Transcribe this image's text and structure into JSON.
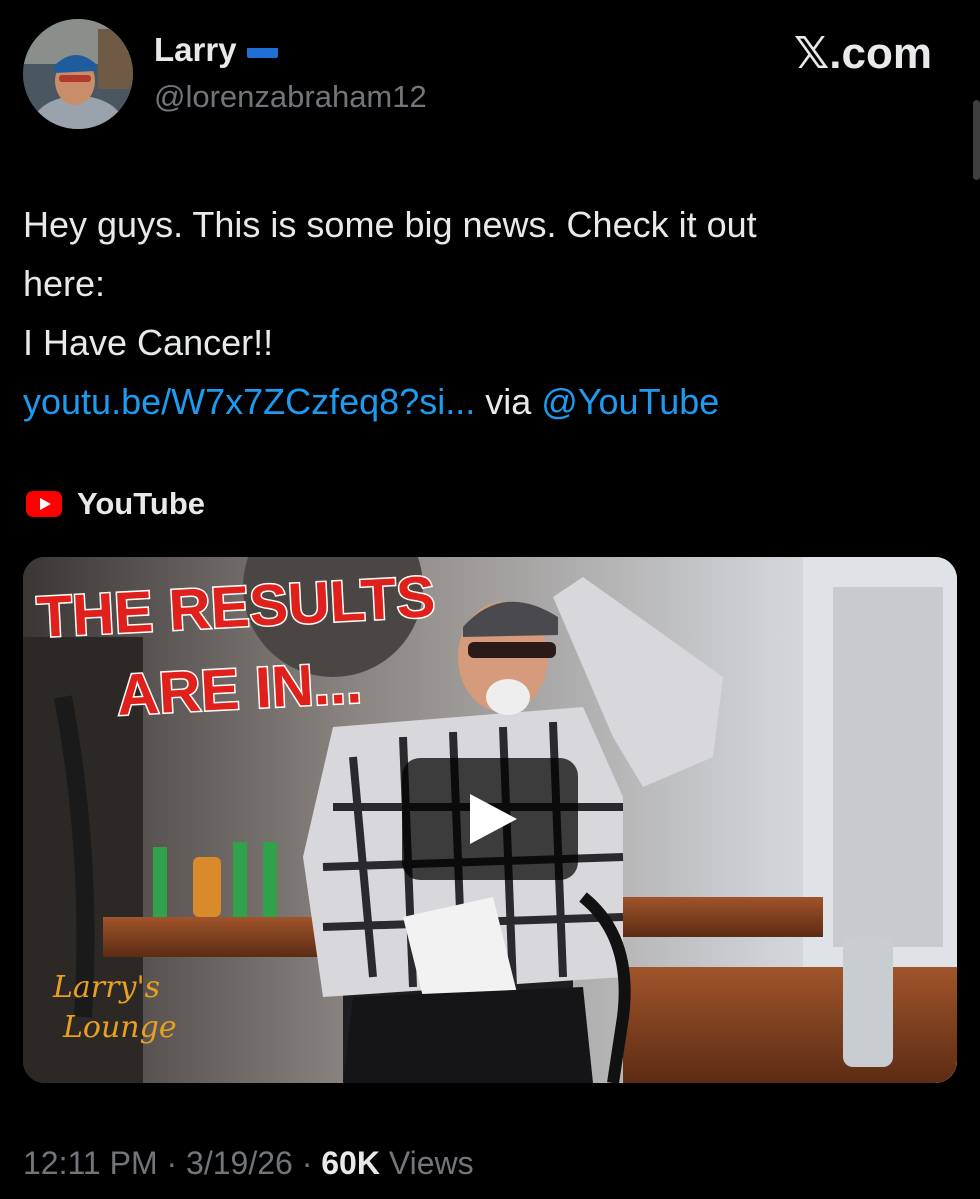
{
  "author": {
    "name": "Larry",
    "handle": "@lorenzabraham12",
    "flag_icon": "ukraine-flag-icon"
  },
  "brand": "𝕏.com",
  "tweet": {
    "line1": "Hey guys. This is some big news. Check it out",
    "line2": "here:",
    "line3": "I Have Cancer!!",
    "link_text": "youtu.be/W7x7ZCzfeq8?si...",
    "via": "via",
    "mention": "@YouTube"
  },
  "card": {
    "source_icon": "youtube-logo-icon",
    "source_name": "YouTube",
    "thumb_title_1": "THE RESULTS",
    "thumb_title_2": "ARE IN...",
    "thumb_logo_1": "Larry's",
    "thumb_logo_2": "Lounge",
    "play_icon": "play-icon"
  },
  "meta": {
    "time": "12:11 PM",
    "sep1": "·",
    "date": "3/19/26",
    "sep2": "·",
    "views_count": "60K",
    "views_label": "Views"
  },
  "colors": {
    "link": "#1d9bf0",
    "muted": "#71767b",
    "text": "#e7e9ea",
    "youtube_red": "#ff0000"
  }
}
